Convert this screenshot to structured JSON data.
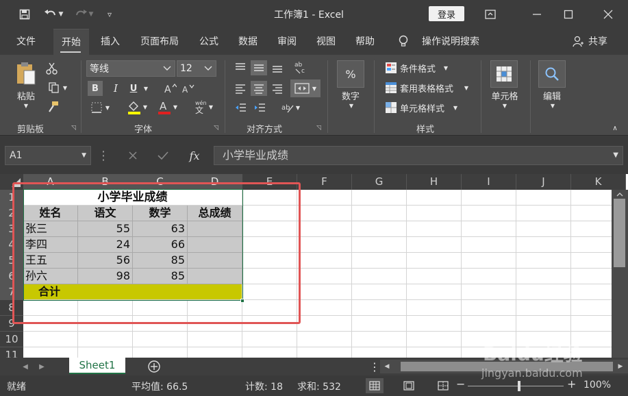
{
  "window": {
    "title": "工作簿1 - Excel",
    "login_label": "登录"
  },
  "tabs": [
    {
      "label": "文件"
    },
    {
      "label": "开始"
    },
    {
      "label": "插入"
    },
    {
      "label": "页面布局"
    },
    {
      "label": "公式"
    },
    {
      "label": "数据"
    },
    {
      "label": "审阅"
    },
    {
      "label": "视图"
    },
    {
      "label": "帮助"
    }
  ],
  "tell_me": "操作说明搜索",
  "share_label": "共享",
  "ribbon": {
    "clipboard": {
      "paste_label": "粘贴",
      "group_label": "剪贴板"
    },
    "font": {
      "font_name": "等线",
      "font_size": "12",
      "bold": "B",
      "italic": "I",
      "underline": "U",
      "group_label": "字体"
    },
    "alignment": {
      "group_label": "对齐方式"
    },
    "number": {
      "label": "数字"
    },
    "styles": {
      "conditional": "条件格式",
      "table_format": "套用表格格式",
      "cell_styles": "单元格样式",
      "group_label": "样式"
    },
    "cells": {
      "label": "单元格"
    },
    "editing": {
      "label": "编辑"
    }
  },
  "formula_bar": {
    "name_box": "A1",
    "fx": "fx",
    "content": "小学毕业成绩"
  },
  "sheet": {
    "columns": [
      "A",
      "B",
      "C",
      "D",
      "E",
      "F",
      "G",
      "H",
      "I",
      "J",
      "K"
    ],
    "rows": [
      "1",
      "2",
      "3",
      "4",
      "5",
      "6",
      "7",
      "8",
      "9",
      "10",
      "11"
    ],
    "title": "小学毕业成绩",
    "headers": [
      "姓名",
      "语文",
      "数学",
      "总成绩"
    ],
    "data": [
      [
        "张三",
        "55",
        "63"
      ],
      [
        "李四",
        "24",
        "66"
      ],
      [
        "王五",
        "56",
        "85"
      ],
      [
        "孙六",
        "98",
        "85"
      ]
    ],
    "total_label": "合计"
  },
  "sheet_tab": "Sheet1",
  "status": {
    "ready": "就绪",
    "average": "平均值: 66.5",
    "count": "计数: 18",
    "sum": "求和: 532",
    "zoom": "100%"
  },
  "watermark": {
    "logo": "Baidu经验",
    "url": "jingyan.baidu.com"
  }
}
